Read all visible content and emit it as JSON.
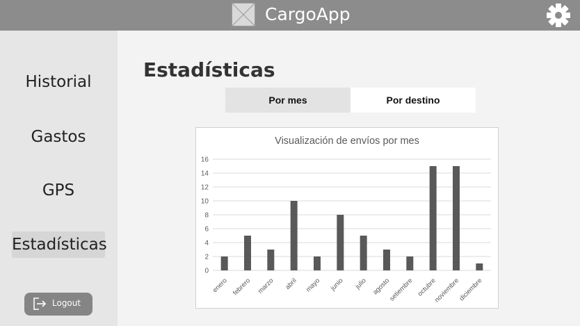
{
  "header": {
    "app_title": "CargoApp",
    "logo_icon": "image-placeholder-icon",
    "settings_icon": "gear-icon"
  },
  "sidebar": {
    "items": [
      {
        "label": "Historial",
        "active": false
      },
      {
        "label": "Gastos",
        "active": false
      },
      {
        "label": "GPS",
        "active": false
      },
      {
        "label": "Estadísticas",
        "active": true
      }
    ],
    "logout_label": "Logout",
    "logout_icon": "logout-icon"
  },
  "main": {
    "title": "Estadísticas",
    "tabs": [
      {
        "label": "Por mes",
        "selected": true
      },
      {
        "label": "Por destino",
        "selected": false
      }
    ]
  },
  "colors": {
    "header_bg": "#8c8c8c",
    "sidebar_bg": "#e6e6e6",
    "bar_color": "#595959"
  },
  "chart_data": {
    "type": "bar",
    "title": "Visualización de envíos por mes",
    "categories": [
      "enero",
      "febrero",
      "marzo",
      "abril",
      "mayo",
      "junio",
      "julio",
      "agosto",
      "setiembre",
      "octubre",
      "noviembre",
      "diciembre"
    ],
    "values": [
      2,
      5,
      3,
      10,
      2,
      8,
      5,
      3,
      2,
      15,
      15,
      1
    ],
    "yticks": [
      0,
      2,
      4,
      6,
      8,
      10,
      12,
      14,
      16
    ],
    "ylim": [
      0,
      16
    ],
    "grid": true,
    "legend": "none"
  }
}
